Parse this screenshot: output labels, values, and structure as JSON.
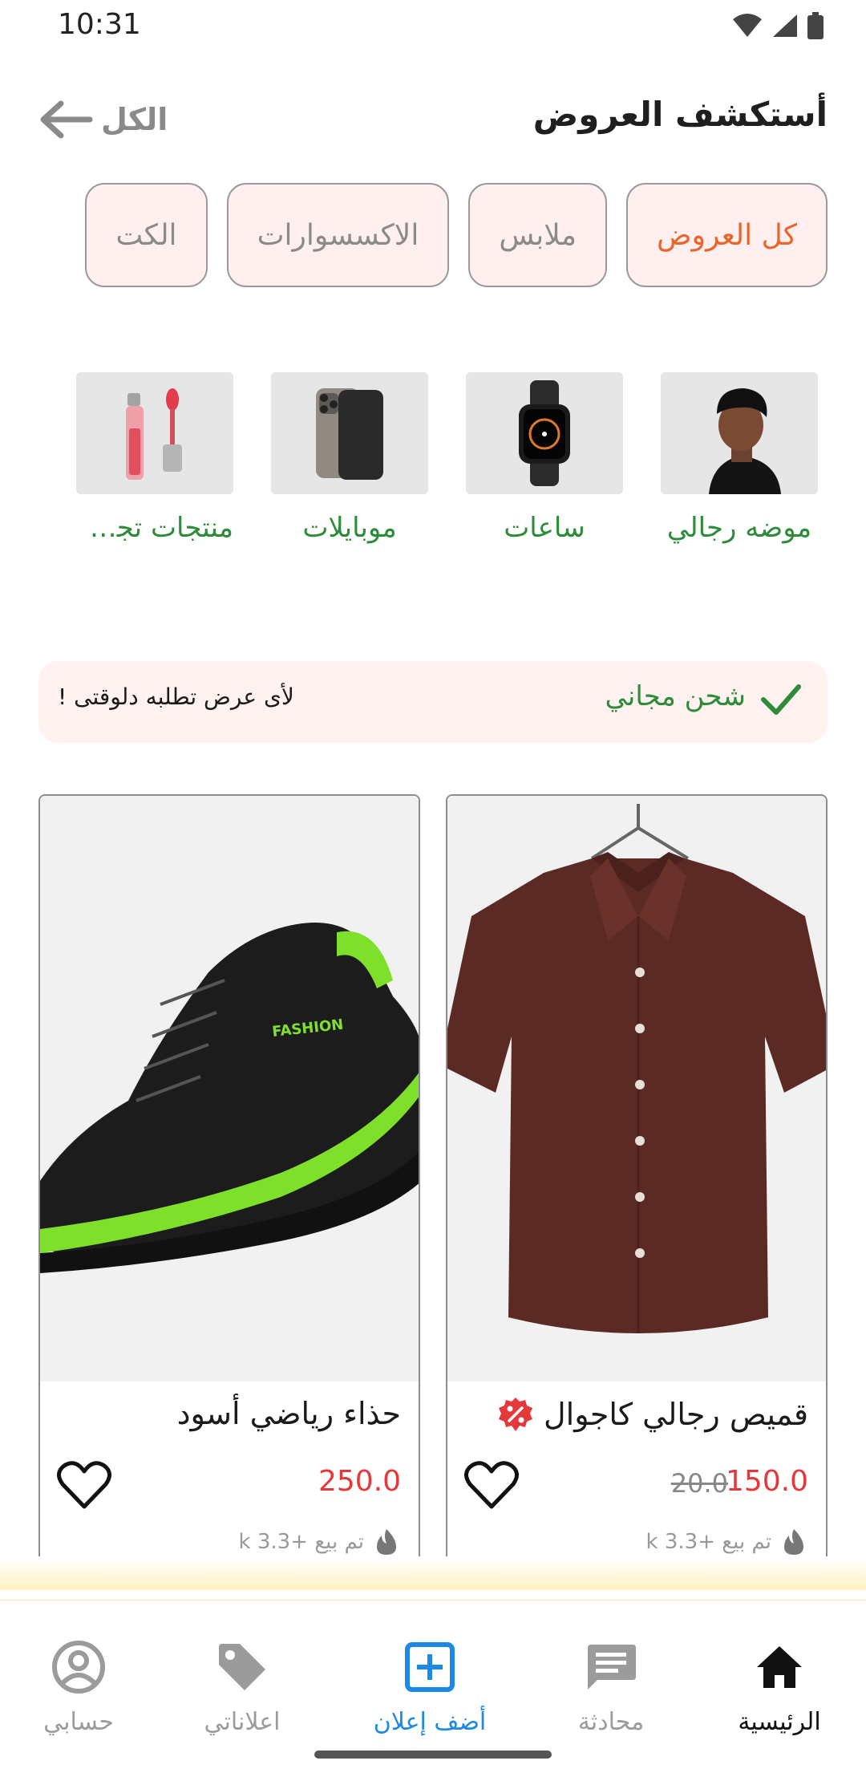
{
  "status_bar": {
    "time": "10:31"
  },
  "header": {
    "title": "أستكشف العروض",
    "see_all": "الكل"
  },
  "chips": [
    {
      "label": "كل العروض",
      "active": true
    },
    {
      "label": "ملابس",
      "active": false
    },
    {
      "label": "الاكسسوارات",
      "active": false
    },
    {
      "label": "الكت",
      "active": false
    }
  ],
  "categories": [
    {
      "label": "موضه رجالي",
      "icon": "man-photo"
    },
    {
      "label": "ساعات",
      "icon": "smartwatch"
    },
    {
      "label": "موبايلات",
      "icon": "smartphone"
    },
    {
      "label": "منتجات تجمي...",
      "icon": "lip-gloss"
    }
  ],
  "promo": {
    "free_shipping": "شحن مجاني",
    "text": "لأى عرض تطلبه دلوقتى !"
  },
  "products": [
    {
      "name": "قميص رجالي كاجوال",
      "price": "150.0",
      "old_price": "20.0",
      "sold": "تم بيع +3.3 k",
      "has_discount_badge": true
    },
    {
      "name": "حذاء رياضي أسود",
      "price": "250.0",
      "old_price": "",
      "sold": "تم بيع +3.3 k",
      "has_discount_badge": false
    }
  ],
  "nav": {
    "home": "الرئيسية",
    "chat": "محادثة",
    "add": "أضف إعلان",
    "my_ads": "اعلاناتي",
    "account": "حسابي"
  },
  "colors": {
    "accent_orange": "#e8662b",
    "green": "#2e8b3a",
    "price_red": "#e5383b",
    "nav_blue": "#1e88e5",
    "chip_bg": "#fff0ef"
  }
}
